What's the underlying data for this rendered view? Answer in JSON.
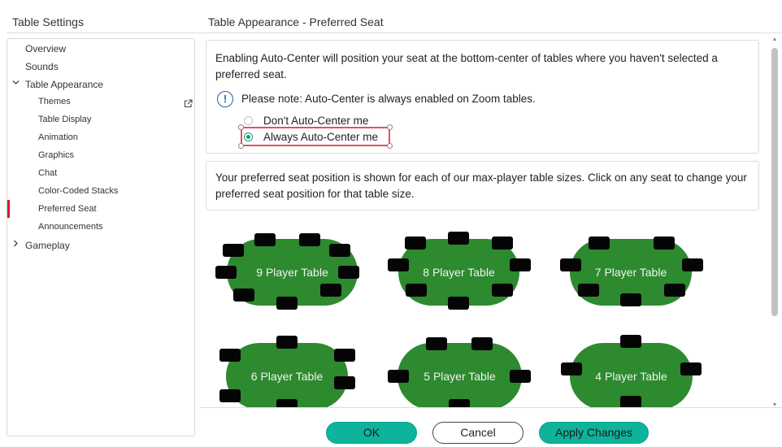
{
  "left": {
    "title": "Table Settings",
    "items": [
      {
        "label": "Overview"
      },
      {
        "label": "Sounds"
      },
      {
        "label": "Table Appearance"
      },
      {
        "label": "Themes"
      },
      {
        "label": "Table Display"
      },
      {
        "label": "Animation"
      },
      {
        "label": "Graphics"
      },
      {
        "label": "Chat"
      },
      {
        "label": "Color-Coded Stacks"
      },
      {
        "label": "Preferred Seat"
      },
      {
        "label": "Announcements"
      },
      {
        "label": "Gameplay"
      }
    ],
    "active_item": "Preferred Seat",
    "accent_color": "#d01a2f"
  },
  "main": {
    "title": "Table Appearance - Preferred Seat",
    "autocenter": {
      "description": "Enabling Auto-Center will position your seat at the bottom-center of tables where you haven't selected a preferred seat.",
      "note": "Please note: Auto-Center is always enabled on Zoom tables.",
      "note_icon": "info-icon",
      "options": [
        {
          "label": "Don't Auto-Center me",
          "selected": false
        },
        {
          "label": "Always Auto-Center me",
          "selected": true
        }
      ]
    },
    "seat_info": "Your preferred seat position is shown for each of our max-player table sizes. Click on any seat to change your preferred seat position for that table size.",
    "tables": [
      {
        "label": "9 Player Table",
        "seats": 9
      },
      {
        "label": "8 Player Table",
        "seats": 8
      },
      {
        "label": "7 Player Table",
        "seats": 7
      },
      {
        "label": "6 Player Table",
        "seats": 6
      },
      {
        "label": "5 Player Table",
        "seats": 5
      },
      {
        "label": "4 Player Table",
        "seats": 4
      }
    ],
    "felt_color": "#2d8a2f"
  },
  "buttons": {
    "ok": "OK",
    "cancel": "Cancel",
    "apply": "Apply Changes",
    "primary_color": "#0db39a"
  }
}
